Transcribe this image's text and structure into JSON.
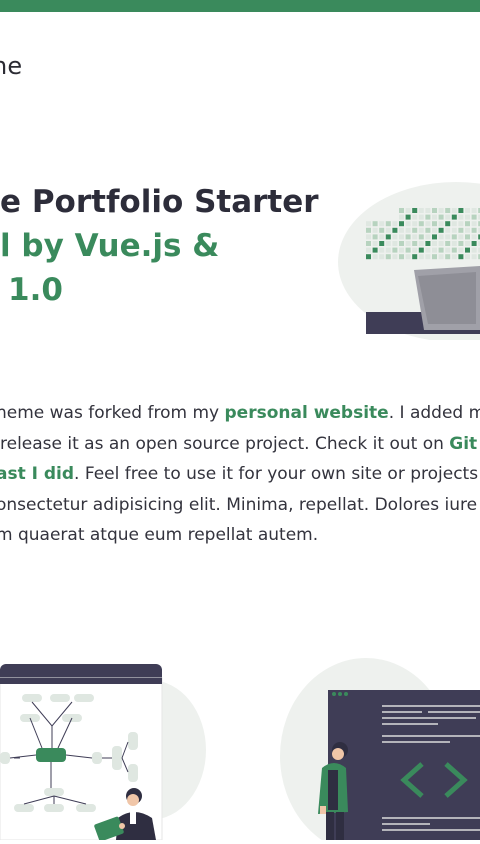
{
  "header": {
    "logo_text": "ne"
  },
  "hero": {
    "line1": "e Portfolio Starter",
    "line2": "l by Vue.js &",
    "line3": "1.0"
  },
  "description": {
    "l1_pre": "heme was forked from my ",
    "l1_link": "personal website",
    "l1_post": ". I added m",
    "l2_pre": "release it as an open source project. Check it out on ",
    "l2_link": "Git",
    "l3_link": "ast I did",
    "l3_post": ". Feel free to use it for your own site or projects",
    "l4": "onsectetur adipisicing elit. Minima, repellat. Dolores iure",
    "l5": "m quaerat atque eum repellat autem."
  },
  "colors": {
    "accent": "#3a8a5c",
    "text_dark": "#2d2d3a",
    "blob": "#eef1ee",
    "panel_dark": "#3f3d56"
  },
  "icons": {
    "hero": "laptop-with-code-grid-illustration",
    "left": "flowchart-board-with-person-illustration",
    "right": "code-editor-with-person-illustration"
  }
}
